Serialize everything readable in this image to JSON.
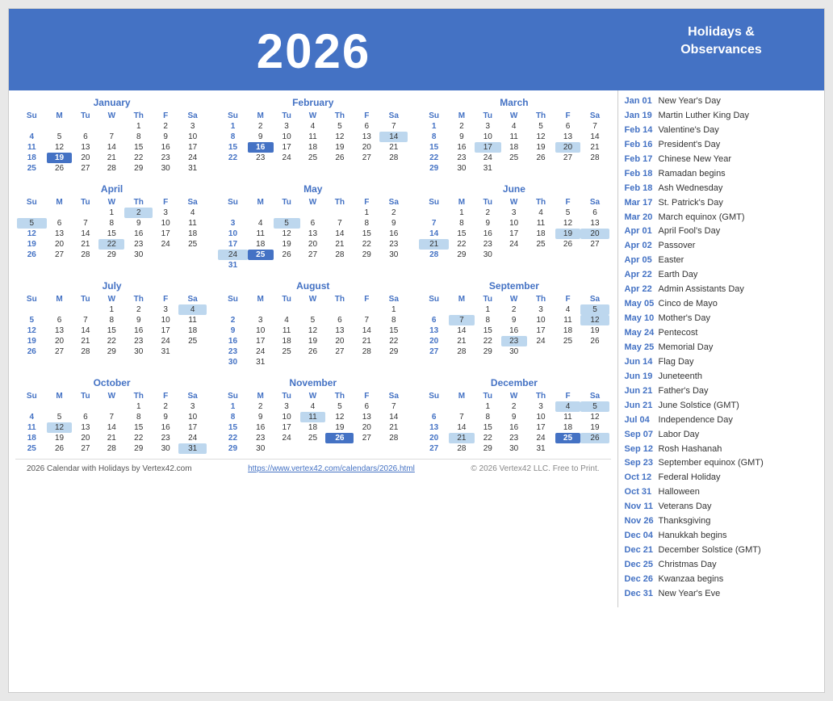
{
  "header": {
    "year": "2026"
  },
  "sidebar": {
    "title": "Holidays &\nObservances",
    "holidays": [
      {
        "date": "Jan 01",
        "name": "New Year's Day"
      },
      {
        "date": "Jan 19",
        "name": "Martin Luther King Day"
      },
      {
        "date": "Feb 14",
        "name": "Valentine's Day"
      },
      {
        "date": "Feb 16",
        "name": "President's Day"
      },
      {
        "date": "Feb 17",
        "name": "Chinese New Year"
      },
      {
        "date": "Feb 18",
        "name": "Ramadan begins"
      },
      {
        "date": "Feb 18",
        "name": "Ash Wednesday"
      },
      {
        "date": "Mar 17",
        "name": "St. Patrick's Day"
      },
      {
        "date": "Mar 20",
        "name": "March equinox (GMT)"
      },
      {
        "date": "Apr 01",
        "name": "April Fool's Day"
      },
      {
        "date": "Apr 02",
        "name": "Passover"
      },
      {
        "date": "Apr 05",
        "name": "Easter"
      },
      {
        "date": "Apr 22",
        "name": "Earth Day"
      },
      {
        "date": "Apr 22",
        "name": "Admin Assistants Day"
      },
      {
        "date": "May 05",
        "name": "Cinco de Mayo"
      },
      {
        "date": "May 10",
        "name": "Mother's Day"
      },
      {
        "date": "May 24",
        "name": "Pentecost"
      },
      {
        "date": "May 25",
        "name": "Memorial Day"
      },
      {
        "date": "Jun 14",
        "name": "Flag Day"
      },
      {
        "date": "Jun 19",
        "name": "Juneteenth"
      },
      {
        "date": "Jun 21",
        "name": "Father's Day"
      },
      {
        "date": "Jun 21",
        "name": "June Solstice (GMT)"
      },
      {
        "date": "Jul 04",
        "name": "Independence Day"
      },
      {
        "date": "Sep 07",
        "name": "Labor Day"
      },
      {
        "date": "Sep 12",
        "name": "Rosh Hashanah"
      },
      {
        "date": "Sep 23",
        "name": "September equinox (GMT)"
      },
      {
        "date": "Oct 12",
        "name": "Federal Holiday"
      },
      {
        "date": "Oct 31",
        "name": "Halloween"
      },
      {
        "date": "Nov 11",
        "name": "Veterans Day"
      },
      {
        "date": "Nov 26",
        "name": "Thanksgiving"
      },
      {
        "date": "Dec 04",
        "name": "Hanukkah begins"
      },
      {
        "date": "Dec 21",
        "name": "December Solstice (GMT)"
      },
      {
        "date": "Dec 25",
        "name": "Christmas Day"
      },
      {
        "date": "Dec 26",
        "name": "Kwanzaa begins"
      },
      {
        "date": "Dec 31",
        "name": "New Year's Eve"
      }
    ]
  },
  "footer": {
    "left": "2026 Calendar with Holidays by Vertex42.com",
    "center": "https://www.vertex42.com/calendars/2026.html",
    "right": "© 2026 Vertex42 LLC. Free to Print."
  },
  "months": [
    {
      "name": "January",
      "headers": [
        "Su",
        "M",
        "Tu",
        "W",
        "Th",
        "F",
        "Sa"
      ],
      "rows": [
        [
          null,
          null,
          null,
          null,
          1,
          2,
          3
        ],
        [
          4,
          5,
          6,
          7,
          8,
          9,
          10
        ],
        [
          11,
          12,
          13,
          14,
          15,
          16,
          17
        ],
        [
          18,
          "19h",
          20,
          21,
          22,
          23,
          24
        ],
        [
          25,
          26,
          27,
          28,
          29,
          30,
          31
        ]
      ]
    },
    {
      "name": "February",
      "headers": [
        "Su",
        "M",
        "Tu",
        "W",
        "Th",
        "F",
        "Sa"
      ],
      "rows": [
        [
          1,
          2,
          3,
          4,
          5,
          6,
          7
        ],
        [
          8,
          9,
          10,
          11,
          12,
          13,
          "14b"
        ],
        [
          15,
          "16h",
          17,
          18,
          19,
          20,
          21
        ],
        [
          22,
          23,
          24,
          25,
          26,
          27,
          28
        ]
      ]
    },
    {
      "name": "March",
      "headers": [
        "Su",
        "M",
        "Tu",
        "W",
        "Th",
        "F",
        "Sa"
      ],
      "rows": [
        [
          1,
          2,
          3,
          4,
          5,
          6,
          7
        ],
        [
          8,
          9,
          10,
          11,
          12,
          13,
          14
        ],
        [
          15,
          16,
          "17b",
          18,
          19,
          "20b",
          21
        ],
        [
          22,
          23,
          24,
          25,
          26,
          27,
          28
        ],
        [
          29,
          30,
          31,
          null,
          null,
          null,
          null
        ]
      ]
    },
    {
      "name": "April",
      "headers": [
        "Su",
        "M",
        "Tu",
        "W",
        "Th",
        "F",
        "Sa"
      ],
      "rows": [
        [
          null,
          null,
          null,
          1,
          "2b",
          3,
          4
        ],
        [
          "5b",
          6,
          7,
          8,
          9,
          10,
          11
        ],
        [
          12,
          13,
          14,
          15,
          16,
          17,
          18
        ],
        [
          19,
          20,
          21,
          "22b",
          23,
          24,
          25
        ],
        [
          26,
          27,
          28,
          29,
          30,
          null,
          null
        ]
      ]
    },
    {
      "name": "May",
      "headers": [
        "Su",
        "M",
        "Tu",
        "W",
        "Th",
        "F",
        "Sa"
      ],
      "rows": [
        [
          null,
          null,
          null,
          null,
          null,
          1,
          2
        ],
        [
          3,
          4,
          "5b",
          6,
          7,
          8,
          9
        ],
        [
          10,
          11,
          12,
          13,
          14,
          15,
          16
        ],
        [
          17,
          18,
          19,
          20,
          21,
          22,
          23
        ],
        [
          "24b",
          "25h",
          26,
          27,
          28,
          29,
          30
        ],
        [
          31,
          null,
          null,
          null,
          null,
          null,
          null
        ]
      ]
    },
    {
      "name": "June",
      "headers": [
        "Su",
        "M",
        "Tu",
        "W",
        "Th",
        "F",
        "Sa"
      ],
      "rows": [
        [
          null,
          1,
          2,
          3,
          4,
          5,
          6
        ],
        [
          7,
          8,
          9,
          10,
          11,
          12,
          13
        ],
        [
          14,
          15,
          16,
          17,
          18,
          "19b",
          "20b"
        ],
        [
          "21b",
          22,
          23,
          24,
          25,
          26,
          27
        ],
        [
          28,
          29,
          30,
          null,
          null,
          null,
          null
        ]
      ]
    },
    {
      "name": "July",
      "headers": [
        "Su",
        "M",
        "Tu",
        "W",
        "Th",
        "F",
        "Sa"
      ],
      "rows": [
        [
          null,
          null,
          null,
          1,
          2,
          3,
          "4b"
        ],
        [
          5,
          6,
          7,
          8,
          9,
          10,
          11
        ],
        [
          12,
          13,
          14,
          15,
          16,
          17,
          18
        ],
        [
          19,
          20,
          21,
          22,
          23,
          24,
          25
        ],
        [
          26,
          27,
          28,
          29,
          30,
          31,
          null
        ]
      ]
    },
    {
      "name": "August",
      "headers": [
        "Su",
        "M",
        "Tu",
        "W",
        "Th",
        "F",
        "Sa"
      ],
      "rows": [
        [
          null,
          null,
          null,
          null,
          null,
          null,
          1
        ],
        [
          2,
          3,
          4,
          5,
          6,
          7,
          8
        ],
        [
          9,
          10,
          11,
          12,
          13,
          14,
          15
        ],
        [
          16,
          17,
          18,
          19,
          20,
          21,
          22
        ],
        [
          23,
          24,
          25,
          26,
          27,
          28,
          29
        ],
        [
          30,
          31,
          null,
          null,
          null,
          null,
          null
        ]
      ]
    },
    {
      "name": "September",
      "headers": [
        "Su",
        "M",
        "Tu",
        "W",
        "Th",
        "F",
        "Sa"
      ],
      "rows": [
        [
          null,
          null,
          1,
          2,
          3,
          4,
          "5b"
        ],
        [
          6,
          "7b",
          8,
          9,
          10,
          11,
          "12b"
        ],
        [
          13,
          14,
          15,
          16,
          17,
          18,
          19
        ],
        [
          20,
          21,
          22,
          "23b",
          24,
          25,
          26
        ],
        [
          27,
          28,
          29,
          30,
          null,
          null,
          null
        ]
      ]
    },
    {
      "name": "October",
      "headers": [
        "Su",
        "M",
        "Tu",
        "W",
        "Th",
        "F",
        "Sa"
      ],
      "rows": [
        [
          null,
          null,
          null,
          null,
          1,
          2,
          3
        ],
        [
          4,
          5,
          6,
          7,
          8,
          9,
          10
        ],
        [
          11,
          "12b",
          13,
          14,
          15,
          16,
          17
        ],
        [
          18,
          19,
          20,
          21,
          22,
          23,
          24
        ],
        [
          25,
          26,
          27,
          28,
          29,
          30,
          "31b"
        ]
      ]
    },
    {
      "name": "November",
      "headers": [
        "Su",
        "M",
        "Tu",
        "W",
        "Th",
        "F",
        "Sa"
      ],
      "rows": [
        [
          1,
          2,
          3,
          4,
          5,
          6,
          7
        ],
        [
          8,
          9,
          10,
          "11b",
          12,
          13,
          14
        ],
        [
          15,
          16,
          17,
          18,
          19,
          20,
          21
        ],
        [
          22,
          23,
          24,
          25,
          "26h",
          27,
          28
        ],
        [
          29,
          30,
          null,
          null,
          null,
          null,
          null
        ]
      ]
    },
    {
      "name": "December",
      "headers": [
        "Su",
        "M",
        "Tu",
        "W",
        "Th",
        "F",
        "Sa"
      ],
      "rows": [
        [
          null,
          null,
          1,
          2,
          3,
          "4b",
          "5b"
        ],
        [
          6,
          7,
          8,
          9,
          10,
          11,
          12
        ],
        [
          13,
          14,
          15,
          16,
          17,
          18,
          19
        ],
        [
          20,
          "21b",
          22,
          23,
          24,
          "25h",
          "26b"
        ],
        [
          27,
          28,
          29,
          30,
          31,
          null,
          null
        ]
      ]
    }
  ]
}
